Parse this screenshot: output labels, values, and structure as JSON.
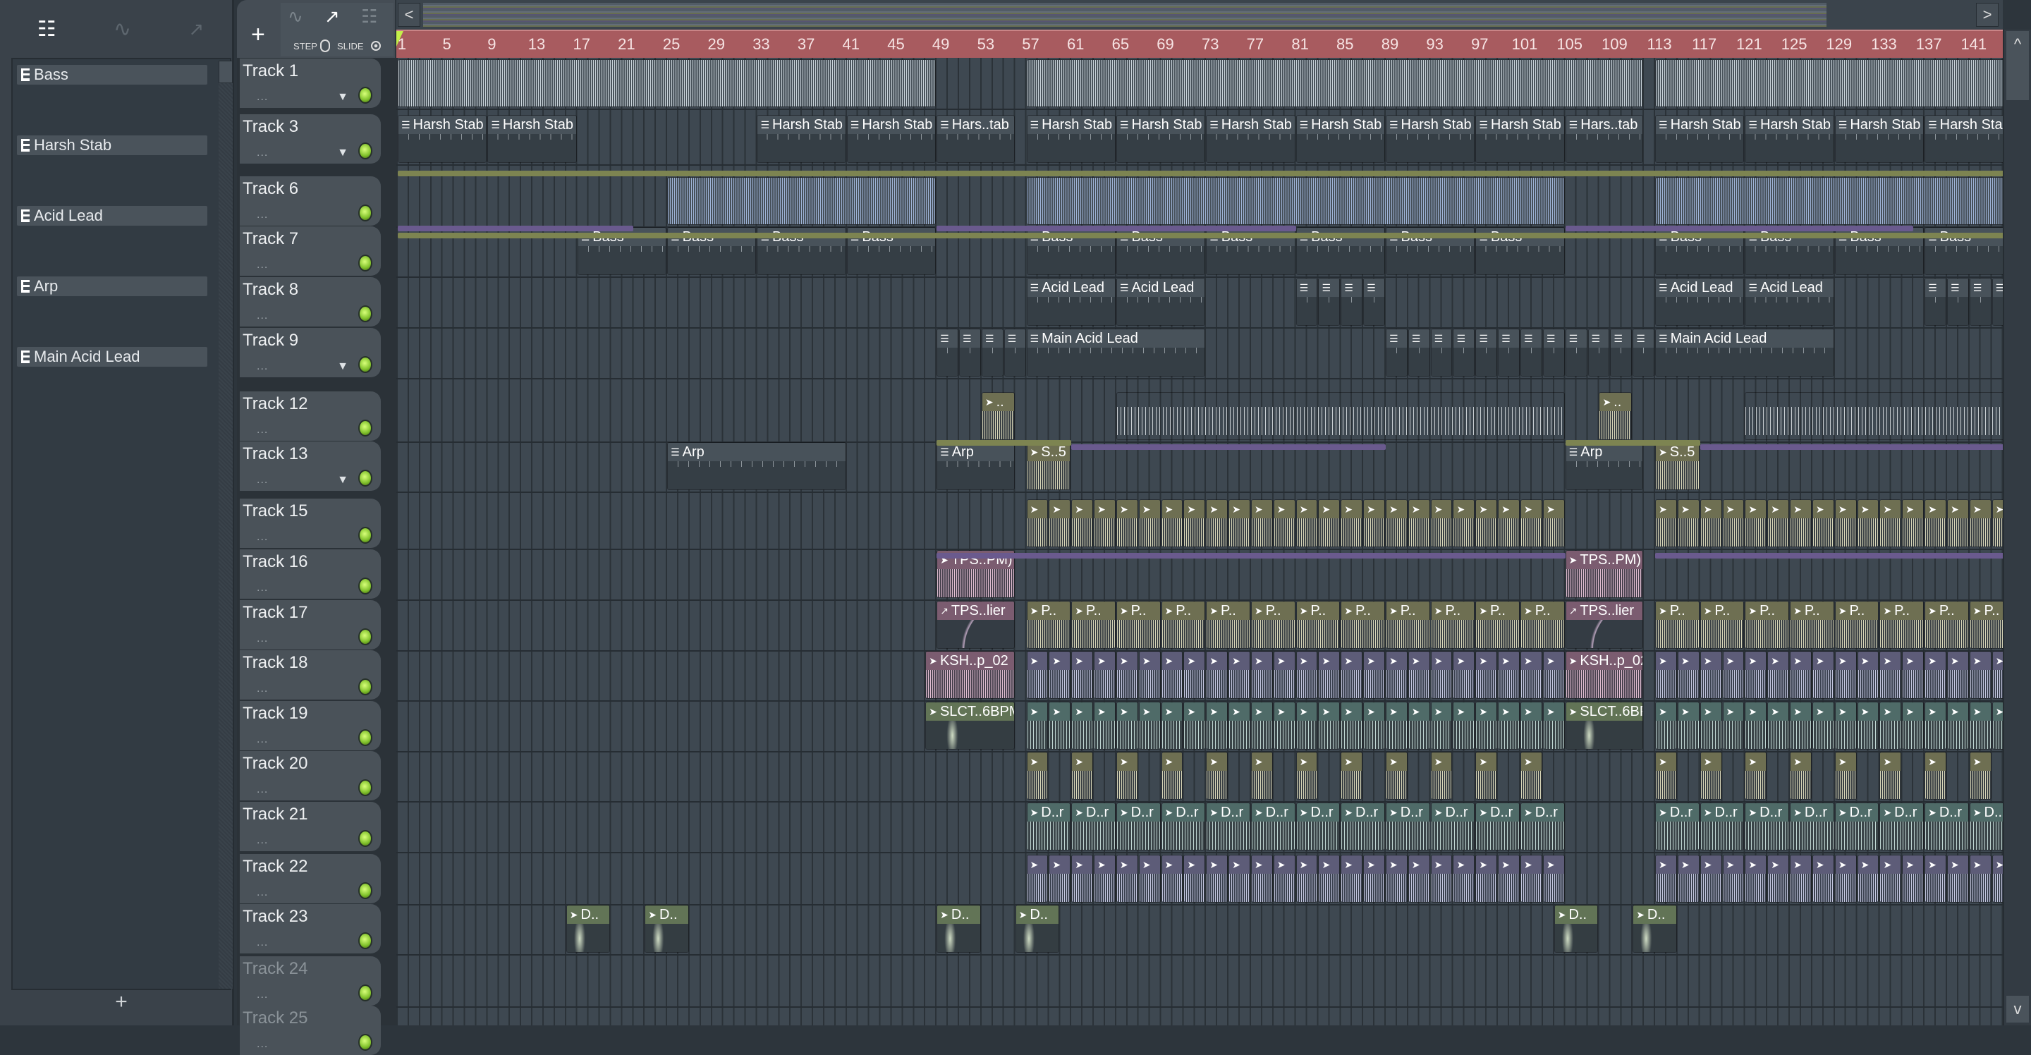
{
  "toolbar": {
    "step_label": "STEP",
    "slide_label": "SLIDE",
    "add": "+"
  },
  "picker": {
    "items": [
      "Bass",
      "Harsh Stab",
      "Acid Lead",
      "Arp",
      "Main Acid Lead"
    ],
    "add": "+"
  },
  "nav": {
    "left": "<",
    "right": ">",
    "up": "^",
    "down": "v"
  },
  "ruler": {
    "ticks": [
      1,
      5,
      9,
      13,
      17,
      21,
      25,
      29,
      33,
      37,
      41,
      45,
      49,
      53,
      57,
      61,
      65,
      69,
      73,
      77,
      81,
      85,
      89,
      93,
      97,
      101,
      105,
      109,
      113,
      117,
      121,
      125,
      129,
      133,
      137,
      141
    ]
  },
  "colors": {
    "ruler": "#a85b5f",
    "led": "#9be03a",
    "grid": "#3e4851"
  },
  "tracks": [
    {
      "name": "Track 1",
      "arrow": true,
      "clips": [
        {
          "s": 1,
          "l": 48,
          "k": "gray",
          "t": ""
        },
        {
          "s": 57,
          "l": 55,
          "k": "gray",
          "t": ""
        },
        {
          "s": 113,
          "l": 32,
          "k": "gray",
          "t": ""
        }
      ]
    },
    {
      "name": "Track 3",
      "arrow": true,
      "clips": [
        {
          "s": 1,
          "l": 8,
          "k": "pattern",
          "t": "Harsh Stab",
          "n": 2
        },
        {
          "s": 33,
          "l": 8,
          "k": "pattern",
          "t": "Harsh Stab",
          "n": 2
        },
        {
          "s": 49,
          "l": 7,
          "k": "pattern",
          "t": "Hars..tab"
        },
        {
          "s": 57,
          "l": 8,
          "k": "pattern",
          "t": "Harsh Stab",
          "n": 6
        },
        {
          "s": 105,
          "l": 7,
          "k": "pattern",
          "t": "Hars..tab"
        },
        {
          "s": 113,
          "l": 8,
          "k": "pattern",
          "t": "Harsh Stab",
          "n": 4
        }
      ]
    },
    {
      "name": "Track 6",
      "clips": [
        {
          "s": 25,
          "l": 24,
          "k": "blue",
          "t": ""
        },
        {
          "s": 57,
          "l": 48,
          "k": "blue",
          "t": ""
        },
        {
          "s": 113,
          "l": 32,
          "k": "blue",
          "t": ""
        }
      ]
    },
    {
      "name": "Track 7",
      "clips": [
        {
          "s": 17,
          "l": 8,
          "k": "pattern",
          "t": "Bass",
          "n": 4
        },
        {
          "s": 57,
          "l": 8,
          "k": "pattern",
          "t": "Bass",
          "n": 6
        },
        {
          "s": 113,
          "l": 8,
          "k": "pattern",
          "t": "Bass",
          "n": 4
        }
      ]
    },
    {
      "name": "Track 8",
      "clips": [
        {
          "s": 57,
          "l": 8,
          "k": "pattern",
          "t": "Acid Lead",
          "n": 2
        },
        {
          "s": 81,
          "l": 2,
          "k": "pattern",
          "t": "",
          "n": 4
        },
        {
          "s": 113,
          "l": 8,
          "k": "pattern",
          "t": "Acid Lead",
          "n": 2
        },
        {
          "s": 137,
          "l": 2,
          "k": "pattern",
          "t": "",
          "n": 4
        }
      ]
    },
    {
      "name": "Track 9",
      "arrow": true,
      "clips": [
        {
          "s": 49,
          "l": 2,
          "k": "pattern",
          "t": "",
          "n": 4
        },
        {
          "s": 57,
          "l": 16,
          "k": "pattern",
          "t": "Main Acid Lead"
        },
        {
          "s": 89,
          "l": 2,
          "k": "pattern",
          "t": "",
          "n": 8
        },
        {
          "s": 105,
          "l": 2,
          "k": "pattern",
          "t": "",
          "n": 4
        },
        {
          "s": 113,
          "l": 16,
          "k": "pattern",
          "t": "Main Acid Lead"
        }
      ]
    },
    {
      "name": "Track 12",
      "clips": [
        {
          "s": 53,
          "l": 3,
          "k": "olive",
          "t": ".."
        },
        {
          "s": 65,
          "l": 40,
          "k": "dense",
          "t": ""
        },
        {
          "s": 108,
          "l": 3,
          "k": "olive",
          "t": ".."
        },
        {
          "s": 121,
          "l": 24,
          "k": "dense",
          "t": ""
        }
      ]
    },
    {
      "name": "Track 13",
      "arrow": true,
      "clips": [
        {
          "s": 25,
          "l": 16,
          "k": "pattern",
          "t": "Arp"
        },
        {
          "s": 49,
          "l": 7,
          "k": "pattern",
          "t": "Arp"
        },
        {
          "s": 57,
          "l": 4,
          "k": "olive",
          "t": "S..5"
        },
        {
          "s": 105,
          "l": 7,
          "k": "pattern",
          "t": "Arp"
        },
        {
          "s": 113,
          "l": 4,
          "k": "olive",
          "t": "S..5"
        }
      ]
    },
    {
      "name": "Track 15",
      "clips": [
        {
          "s": 57,
          "l": 2,
          "k": "olive",
          "t": "",
          "n": 24
        },
        {
          "s": 113,
          "l": 2,
          "k": "olive",
          "t": "",
          "n": 16
        }
      ]
    },
    {
      "name": "Track 16",
      "clips": [
        {
          "s": 49,
          "l": 7,
          "k": "pink",
          "t": "TPS..PM)"
        },
        {
          "s": 105,
          "l": 7,
          "k": "pink",
          "t": "TPS..PM)"
        }
      ]
    },
    {
      "name": "Track 17",
      "clips": [
        {
          "s": 49,
          "l": 7,
          "k": "auto",
          "t": "TPS..lier"
        },
        {
          "s": 57,
          "l": 4,
          "k": "olive",
          "t": "P..",
          "n": 12
        },
        {
          "s": 105,
          "l": 7,
          "k": "auto",
          "t": "TPS..lier"
        },
        {
          "s": 113,
          "l": 4,
          "k": "olive",
          "t": "P..",
          "n": 8
        }
      ]
    },
    {
      "name": "Track 18",
      "clips": [
        {
          "s": 48,
          "l": 8,
          "k": "pink",
          "t": "KSH..p_02"
        },
        {
          "s": 57,
          "l": 2,
          "k": "audio",
          "t": "",
          "n": 24
        },
        {
          "s": 105,
          "l": 7,
          "k": "pink",
          "t": "KSH..p_02"
        },
        {
          "s": 113,
          "l": 2,
          "k": "audio",
          "t": "",
          "n": 16
        }
      ]
    },
    {
      "name": "Track 19",
      "clips": [
        {
          "s": 48,
          "l": 8,
          "k": "sage",
          "t": "SLCT..6BPM"
        },
        {
          "s": 57,
          "l": 2,
          "k": "teal",
          "t": "",
          "n": 24
        },
        {
          "s": 105,
          "l": 7,
          "k": "sage",
          "t": "SLCT..6BPM"
        },
        {
          "s": 113,
          "l": 2,
          "k": "teal",
          "t": "",
          "n": 16
        }
      ]
    },
    {
      "name": "Track 20",
      "clips": [
        {
          "s": 57,
          "l": 2,
          "k": "olive",
          "t": "",
          "n": 12,
          "g": 4
        },
        {
          "s": 113,
          "l": 2,
          "k": "olive",
          "t": "",
          "n": 8,
          "g": 4
        }
      ]
    },
    {
      "name": "Track 21",
      "clips": [
        {
          "s": 57,
          "l": 4,
          "k": "teal",
          "t": "D..r",
          "n": 12
        },
        {
          "s": 113,
          "l": 4,
          "k": "teal",
          "t": "D..r",
          "n": 8
        }
      ]
    },
    {
      "name": "Track 22",
      "clips": [
        {
          "s": 57,
          "l": 2,
          "k": "audio",
          "t": "",
          "n": 24
        },
        {
          "s": 113,
          "l": 2,
          "k": "audio",
          "t": "",
          "n": 16
        }
      ]
    },
    {
      "name": "Track 23",
      "clips": [
        {
          "s": 16,
          "l": 4,
          "k": "sage",
          "t": "D.."
        },
        {
          "s": 23,
          "l": 4,
          "k": "sage",
          "t": "D.."
        },
        {
          "s": 49,
          "l": 4,
          "k": "sage",
          "t": "D.."
        },
        {
          "s": 56,
          "l": 4,
          "k": "sage",
          "t": "D.."
        },
        {
          "s": 104,
          "l": 4,
          "k": "sage",
          "t": "D.."
        },
        {
          "s": 111,
          "l": 4,
          "k": "sage",
          "t": "D.."
        }
      ]
    },
    {
      "name": "Track 24",
      "dim": true,
      "clips": []
    },
    {
      "name": "Track 25",
      "dim": true,
      "clips": []
    }
  ]
}
